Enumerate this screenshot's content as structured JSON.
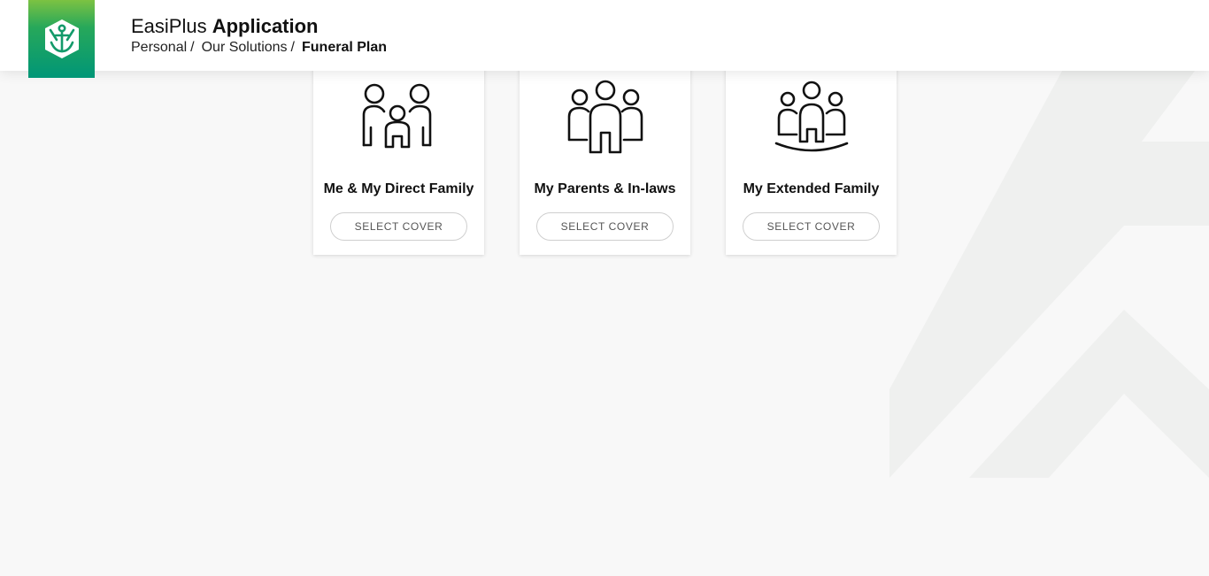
{
  "header": {
    "title_light": "EasiPlus",
    "title_bold": "Application",
    "breadcrumb": [
      {
        "label": "Personal"
      },
      {
        "label": "Our Solutions"
      },
      {
        "label": "Funeral Plan"
      }
    ],
    "breadcrumb_separator": "/"
  },
  "logo": {
    "icon": "shield-anchor-icon",
    "gradient": [
      "#7cc242",
      "#009677"
    ]
  },
  "cards": [
    {
      "title": "Me & My Direct Family",
      "icon": "family-parents-child-icon",
      "button": "SELECT COVER"
    },
    {
      "title": "My Parents & In-laws",
      "icon": "family-three-adults-icon",
      "button": "SELECT COVER"
    },
    {
      "title": "My Extended Family",
      "icon": "extended-family-group-icon",
      "button": "SELECT COVER"
    }
  ],
  "colors": {
    "background": "#f8f8f8",
    "card": "#ffffff",
    "button_border": "#cfcfcf",
    "button_text": "#555555"
  }
}
